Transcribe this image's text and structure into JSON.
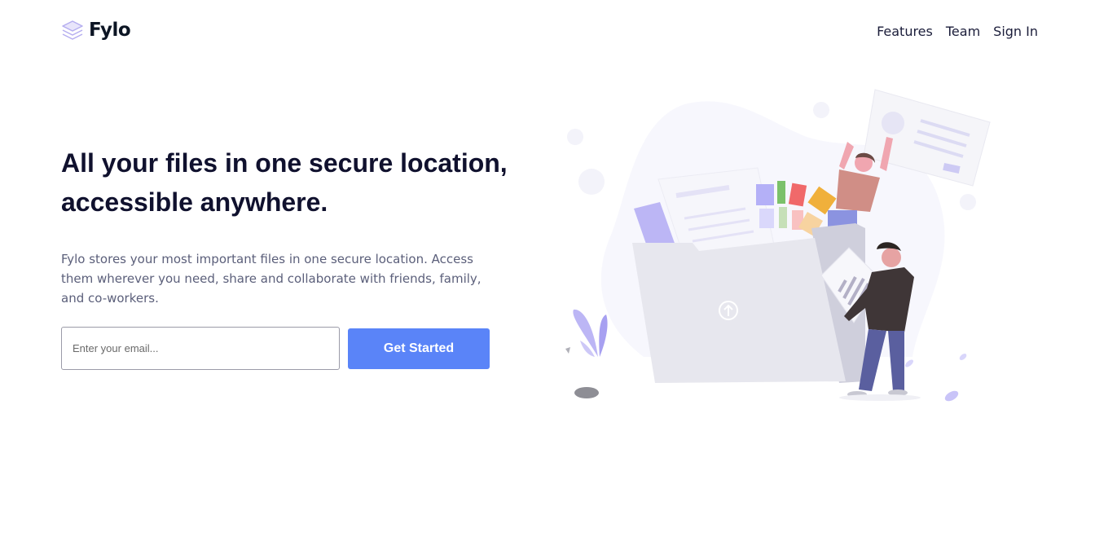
{
  "header": {
    "logo_text": "Fylo",
    "nav": [
      {
        "label": "Features"
      },
      {
        "label": "Team"
      },
      {
        "label": "Sign In"
      }
    ]
  },
  "hero": {
    "headline": "All your files in one secure location, accessible anywhere.",
    "description": "Fylo stores your most important files in one secure location. Access them wherever you need, share and collaborate with friends, family, and co-workers.",
    "email_placeholder": "Enter your email...",
    "email_value": "",
    "cta_label": "Get Started"
  },
  "icons": {
    "logo": "stacked-layers-icon",
    "upload": "upload-arrow-icon"
  },
  "colors": {
    "primary": "#5a84f8",
    "heading": "#10112e",
    "body_text": "#5b5f7a",
    "logo_accent": "#b5aef0",
    "blob": "#f7f7fd"
  }
}
